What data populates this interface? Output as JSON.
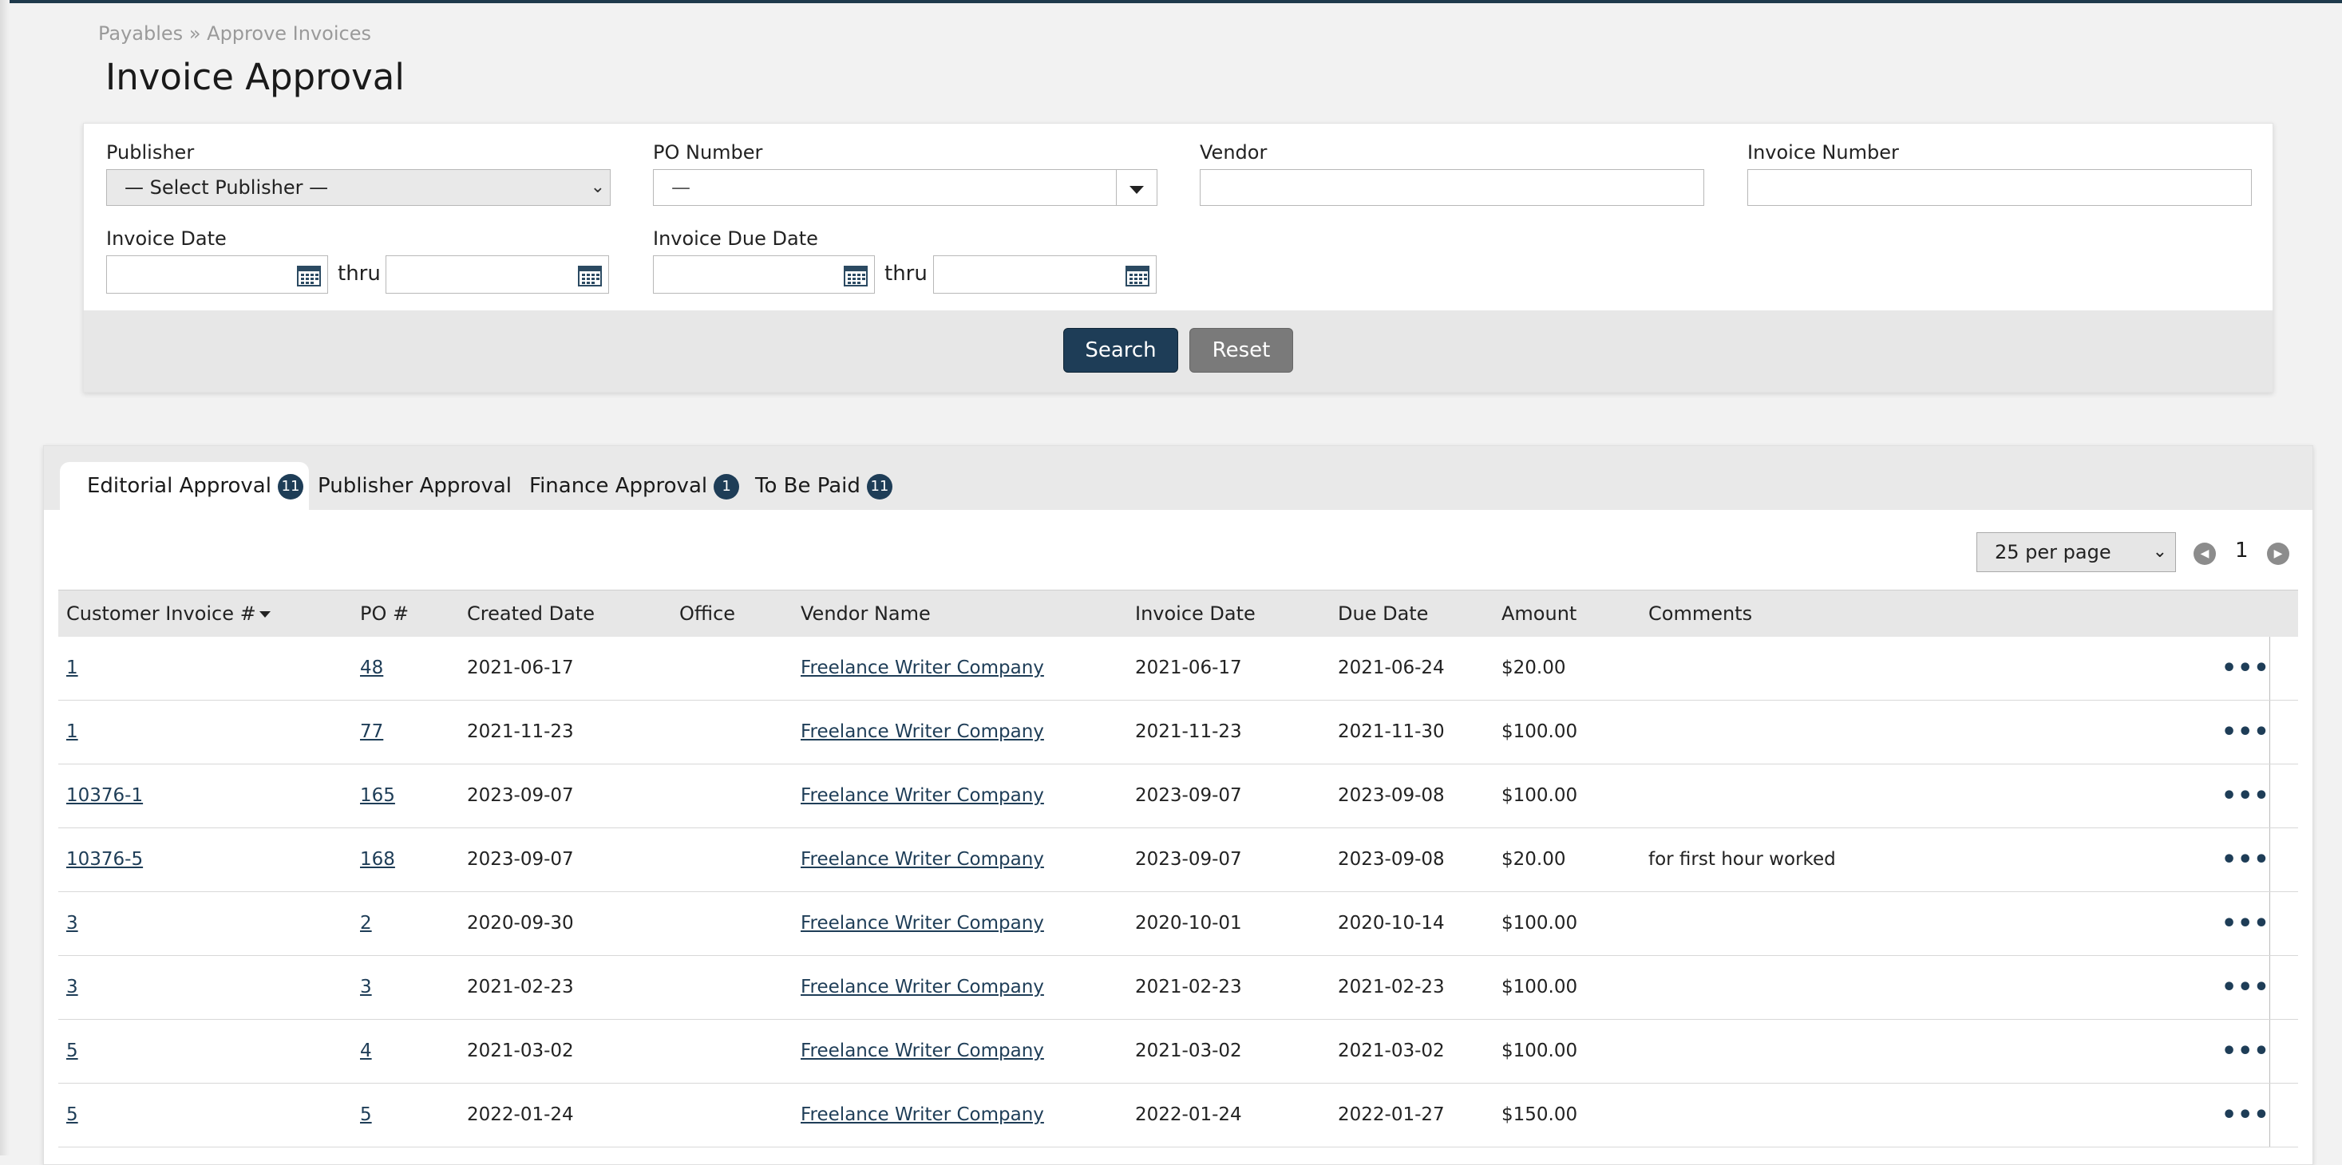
{
  "breadcrumb": {
    "parent": "Payables",
    "separator": "»",
    "current": "Approve Invoices"
  },
  "page_title": "Invoice Approval",
  "filters": {
    "publisher": {
      "label": "Publisher",
      "value": "— Select Publisher —"
    },
    "po_number": {
      "label": "PO Number",
      "value": "—"
    },
    "vendor": {
      "label": "Vendor",
      "value": ""
    },
    "invoice_number": {
      "label": "Invoice Number",
      "value": ""
    },
    "invoice_date": {
      "label": "Invoice Date",
      "thru": "thru"
    },
    "invoice_due_date": {
      "label": "Invoice Due Date",
      "thru": "thru"
    },
    "search_label": "Search",
    "reset_label": "Reset"
  },
  "tabs": [
    {
      "label": "Editorial Approval",
      "badge": "11",
      "active": true
    },
    {
      "label": "Publisher Approval",
      "badge": ""
    },
    {
      "label": "Finance Approval",
      "badge": "1"
    },
    {
      "label": "To Be Paid",
      "badge": "11"
    }
  ],
  "pagination": {
    "per_page": "25 per page",
    "current_page": "1"
  },
  "table": {
    "columns": [
      "Customer Invoice #",
      "PO #",
      "Created Date",
      "Office",
      "Vendor Name",
      "Invoice Date",
      "Due Date",
      "Amount",
      "Comments"
    ],
    "rows": [
      {
        "customer_invoice": "1",
        "po": "48",
        "created": "2021-06-17",
        "office": "",
        "vendor": "Freelance Writer Company",
        "invoice_date": "2021-06-17",
        "due_date": "2021-06-24",
        "amount": "$20.00",
        "comments": ""
      },
      {
        "customer_invoice": "1",
        "po": "77",
        "created": "2021-11-23",
        "office": "",
        "vendor": "Freelance Writer Company",
        "invoice_date": "2021-11-23",
        "due_date": "2021-11-30",
        "amount": "$100.00",
        "comments": ""
      },
      {
        "customer_invoice": "10376-1",
        "po": "165",
        "created": "2023-09-07",
        "office": "",
        "vendor": "Freelance Writer Company",
        "invoice_date": "2023-09-07",
        "due_date": "2023-09-08",
        "amount": "$100.00",
        "comments": ""
      },
      {
        "customer_invoice": "10376-5",
        "po": "168",
        "created": "2023-09-07",
        "office": "",
        "vendor": "Freelance Writer Company",
        "invoice_date": "2023-09-07",
        "due_date": "2023-09-08",
        "amount": "$20.00",
        "comments": "for first hour worked"
      },
      {
        "customer_invoice": "3",
        "po": "2",
        "created": "2020-09-30",
        "office": "",
        "vendor": "Freelance Writer Company",
        "invoice_date": "2020-10-01",
        "due_date": "2020-10-14",
        "amount": "$100.00",
        "comments": ""
      },
      {
        "customer_invoice": "3",
        "po": "3",
        "created": "2021-02-23",
        "office": "",
        "vendor": "Freelance Writer Company",
        "invoice_date": "2021-02-23",
        "due_date": "2021-02-23",
        "amount": "$100.00",
        "comments": ""
      },
      {
        "customer_invoice": "5",
        "po": "4",
        "created": "2021-03-02",
        "office": "",
        "vendor": "Freelance Writer Company",
        "invoice_date": "2021-03-02",
        "due_date": "2021-03-02",
        "amount": "$100.00",
        "comments": ""
      },
      {
        "customer_invoice": "5",
        "po": "5",
        "created": "2022-01-24",
        "office": "",
        "vendor": "Freelance Writer Company",
        "invoice_date": "2022-01-24",
        "due_date": "2022-01-27",
        "amount": "$150.00",
        "comments": ""
      }
    ],
    "row_menu_glyph": "•••"
  },
  "colors": {
    "accent": "#1e3d57",
    "reset": "#7a7a7a",
    "header_bg": "#e7e7e7"
  },
  "icons": {
    "calendar": "calendar-icon",
    "row_menu": "ellipsis-icon",
    "prev": "chevron-left-icon",
    "next": "chevron-right-icon"
  }
}
